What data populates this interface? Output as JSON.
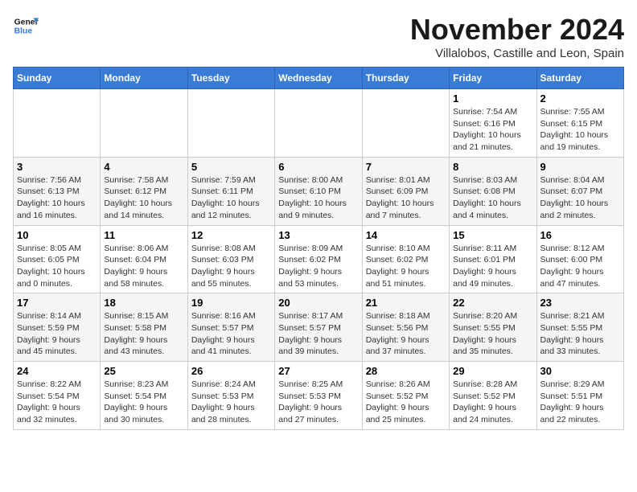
{
  "logo": {
    "line1": "General",
    "line2": "Blue"
  },
  "title": "November 2024",
  "subtitle": "Villalobos, Castille and Leon, Spain",
  "headers": [
    "Sunday",
    "Monday",
    "Tuesday",
    "Wednesday",
    "Thursday",
    "Friday",
    "Saturday"
  ],
  "weeks": [
    [
      {
        "day": "",
        "info": ""
      },
      {
        "day": "",
        "info": ""
      },
      {
        "day": "",
        "info": ""
      },
      {
        "day": "",
        "info": ""
      },
      {
        "day": "",
        "info": ""
      },
      {
        "day": "1",
        "info": "Sunrise: 7:54 AM\nSunset: 6:16 PM\nDaylight: 10 hours\nand 21 minutes."
      },
      {
        "day": "2",
        "info": "Sunrise: 7:55 AM\nSunset: 6:15 PM\nDaylight: 10 hours\nand 19 minutes."
      }
    ],
    [
      {
        "day": "3",
        "info": "Sunrise: 7:56 AM\nSunset: 6:13 PM\nDaylight: 10 hours\nand 16 minutes."
      },
      {
        "day": "4",
        "info": "Sunrise: 7:58 AM\nSunset: 6:12 PM\nDaylight: 10 hours\nand 14 minutes."
      },
      {
        "day": "5",
        "info": "Sunrise: 7:59 AM\nSunset: 6:11 PM\nDaylight: 10 hours\nand 12 minutes."
      },
      {
        "day": "6",
        "info": "Sunrise: 8:00 AM\nSunset: 6:10 PM\nDaylight: 10 hours\nand 9 minutes."
      },
      {
        "day": "7",
        "info": "Sunrise: 8:01 AM\nSunset: 6:09 PM\nDaylight: 10 hours\nand 7 minutes."
      },
      {
        "day": "8",
        "info": "Sunrise: 8:03 AM\nSunset: 6:08 PM\nDaylight: 10 hours\nand 4 minutes."
      },
      {
        "day": "9",
        "info": "Sunrise: 8:04 AM\nSunset: 6:07 PM\nDaylight: 10 hours\nand 2 minutes."
      }
    ],
    [
      {
        "day": "10",
        "info": "Sunrise: 8:05 AM\nSunset: 6:05 PM\nDaylight: 10 hours\nand 0 minutes."
      },
      {
        "day": "11",
        "info": "Sunrise: 8:06 AM\nSunset: 6:04 PM\nDaylight: 9 hours\nand 58 minutes."
      },
      {
        "day": "12",
        "info": "Sunrise: 8:08 AM\nSunset: 6:03 PM\nDaylight: 9 hours\nand 55 minutes."
      },
      {
        "day": "13",
        "info": "Sunrise: 8:09 AM\nSunset: 6:02 PM\nDaylight: 9 hours\nand 53 minutes."
      },
      {
        "day": "14",
        "info": "Sunrise: 8:10 AM\nSunset: 6:02 PM\nDaylight: 9 hours\nand 51 minutes."
      },
      {
        "day": "15",
        "info": "Sunrise: 8:11 AM\nSunset: 6:01 PM\nDaylight: 9 hours\nand 49 minutes."
      },
      {
        "day": "16",
        "info": "Sunrise: 8:12 AM\nSunset: 6:00 PM\nDaylight: 9 hours\nand 47 minutes."
      }
    ],
    [
      {
        "day": "17",
        "info": "Sunrise: 8:14 AM\nSunset: 5:59 PM\nDaylight: 9 hours\nand 45 minutes."
      },
      {
        "day": "18",
        "info": "Sunrise: 8:15 AM\nSunset: 5:58 PM\nDaylight: 9 hours\nand 43 minutes."
      },
      {
        "day": "19",
        "info": "Sunrise: 8:16 AM\nSunset: 5:57 PM\nDaylight: 9 hours\nand 41 minutes."
      },
      {
        "day": "20",
        "info": "Sunrise: 8:17 AM\nSunset: 5:57 PM\nDaylight: 9 hours\nand 39 minutes."
      },
      {
        "day": "21",
        "info": "Sunrise: 8:18 AM\nSunset: 5:56 PM\nDaylight: 9 hours\nand 37 minutes."
      },
      {
        "day": "22",
        "info": "Sunrise: 8:20 AM\nSunset: 5:55 PM\nDaylight: 9 hours\nand 35 minutes."
      },
      {
        "day": "23",
        "info": "Sunrise: 8:21 AM\nSunset: 5:55 PM\nDaylight: 9 hours\nand 33 minutes."
      }
    ],
    [
      {
        "day": "24",
        "info": "Sunrise: 8:22 AM\nSunset: 5:54 PM\nDaylight: 9 hours\nand 32 minutes."
      },
      {
        "day": "25",
        "info": "Sunrise: 8:23 AM\nSunset: 5:54 PM\nDaylight: 9 hours\nand 30 minutes."
      },
      {
        "day": "26",
        "info": "Sunrise: 8:24 AM\nSunset: 5:53 PM\nDaylight: 9 hours\nand 28 minutes."
      },
      {
        "day": "27",
        "info": "Sunrise: 8:25 AM\nSunset: 5:53 PM\nDaylight: 9 hours\nand 27 minutes."
      },
      {
        "day": "28",
        "info": "Sunrise: 8:26 AM\nSunset: 5:52 PM\nDaylight: 9 hours\nand 25 minutes."
      },
      {
        "day": "29",
        "info": "Sunrise: 8:28 AM\nSunset: 5:52 PM\nDaylight: 9 hours\nand 24 minutes."
      },
      {
        "day": "30",
        "info": "Sunrise: 8:29 AM\nSunset: 5:51 PM\nDaylight: 9 hours\nand 22 minutes."
      }
    ]
  ]
}
